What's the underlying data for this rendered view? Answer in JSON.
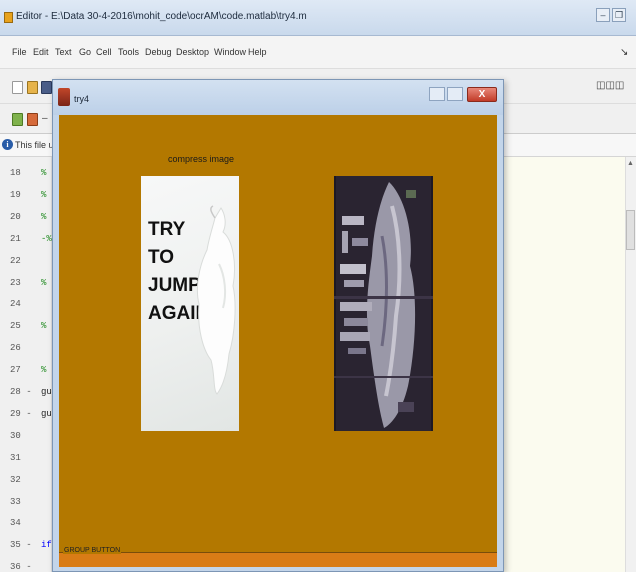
{
  "editor": {
    "title": "Editor - E:\\Data 30-4-2016\\mohit_code\\ocrAM\\code.matlab\\try4.m",
    "menu": [
      "File",
      "Edit",
      "Text",
      "Go",
      "Cell",
      "Tools",
      "Debug",
      "Desktop",
      "Window",
      "Help"
    ],
    "toolbar2_value": "1",
    "info_text": "This file uses C",
    "lines": [
      {
        "num": "18",
        "code": "%"
      },
      {
        "num": "19",
        "code": "%"
      },
      {
        "num": "20",
        "code": "%"
      },
      {
        "num": "21",
        "code": "-% S"
      },
      {
        "num": "22",
        "code": ""
      },
      {
        "num": "23",
        "code": "% E"
      },
      {
        "num": "24",
        "code": ""
      },
      {
        "num": "25",
        "code": "% L"
      },
      {
        "num": "26",
        "code": ""
      },
      {
        "num": "27",
        "code": "% E"
      },
      {
        "num": "28 -",
        "code": "gui"
      },
      {
        "num": "29 -",
        "code": "gui"
      },
      {
        "num": "30",
        "code": ""
      },
      {
        "num": "31",
        "code": ""
      },
      {
        "num": "32",
        "code": ""
      },
      {
        "num": "33",
        "code": ""
      },
      {
        "num": "34",
        "code": ""
      },
      {
        "num": "35 -",
        "code": "if"
      },
      {
        "num": "36 -",
        "code": ""
      }
    ]
  },
  "figure": {
    "title": "try4",
    "close_label": "X",
    "heading": "compress image",
    "left_image_text": "TRY\nTO\nJUMP\nAGAIN",
    "group_label": "GROUP BUTTON"
  },
  "colors": {
    "figure_background": "#b37800",
    "group_panel": "#d97c16",
    "code_background": "#fbfbef"
  }
}
